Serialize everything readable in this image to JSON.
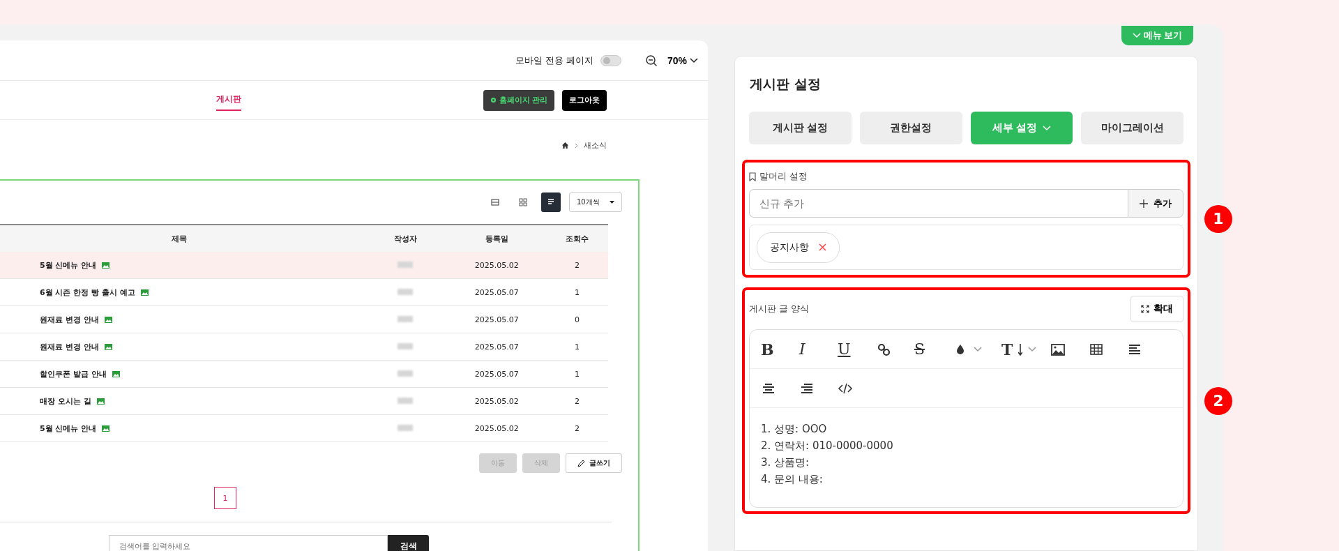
{
  "preview": {
    "mobile_toggle": {
      "label": "모바일 전용 페이지",
      "on": false
    },
    "zoom": "70%",
    "nav": [
      {
        "label": "게시판",
        "selected": true
      }
    ],
    "buttons": [
      {
        "label": "홈페이지 관리",
        "kind": "manage"
      },
      {
        "label": "로그아웃",
        "kind": "dark"
      }
    ],
    "breadcrumb": [
      "새소식"
    ],
    "view_modes": [
      {
        "selected": false
      },
      {
        "selected": false
      },
      {
        "selected": true
      }
    ],
    "page_size": "10개씩",
    "table": {
      "columns": [
        "제목",
        "작성자",
        "등록일",
        "조회수"
      ],
      "rows": [
        {
          "title": "5월 신메뉴 안내",
          "date": "2025.05.02",
          "views": "2",
          "selected": true
        },
        {
          "title": "6월 시즌 한정 빵 출시 예고",
          "date": "2025.05.07",
          "views": "1",
          "selected": false
        },
        {
          "title": "원재료 변경 안내",
          "date": "2025.05.07",
          "views": "0",
          "selected": false
        },
        {
          "title": "원재료 변경 안내",
          "date": "2025.05.07",
          "views": "1",
          "selected": false
        },
        {
          "title": "할인쿠폰 발급 안내",
          "date": "2025.05.07",
          "views": "1",
          "selected": false
        },
        {
          "title": "매장 오시는 길",
          "date": "2025.05.02",
          "views": "2",
          "selected": false
        },
        {
          "title": "5월 신메뉴 안내",
          "date": "2025.05.02",
          "views": "2",
          "selected": false
        }
      ]
    },
    "actions": [
      {
        "label": "이동",
        "disabled": true,
        "kind": "plain"
      },
      {
        "label": "삭제",
        "disabled": true,
        "kind": "plain"
      },
      {
        "label": "글쓰기",
        "disabled": false,
        "kind": "write"
      }
    ],
    "pages": [
      {
        "label": "1",
        "selected": true
      }
    ],
    "search": {
      "placeholder": "검색어를 입력하세요",
      "button": "검색"
    }
  },
  "settings": {
    "menu_button": "메뉴 보기",
    "title": "게시판 설정",
    "tabs": [
      {
        "label": "게시판 설정",
        "selected": false,
        "dropdown": false
      },
      {
        "label": "권한설정",
        "selected": false,
        "dropdown": false
      },
      {
        "label": "세부 설정",
        "selected": true,
        "dropdown": true
      },
      {
        "label": "마이그레이션",
        "selected": false,
        "dropdown": false
      }
    ],
    "header_section": {
      "annotation": "1",
      "title": "말머리 설정",
      "input": {
        "placeholder": "신규 추가"
      },
      "add_button": "추가",
      "tags": [
        "공지사항"
      ]
    },
    "template_section": {
      "annotation": "2",
      "title": "게시판 글 양식",
      "expand_button": "확대",
      "toolbar": [
        [
          {
            "kind": "bold",
            "label": "B",
            "dropdown": false
          },
          {
            "kind": "italic",
            "label": "I",
            "dropdown": false
          },
          {
            "kind": "underline",
            "label": "U",
            "dropdown": false
          },
          {
            "kind": "link",
            "dropdown": false
          },
          {
            "kind": "strike",
            "label": "S",
            "dropdown": false
          },
          {
            "kind": "color",
            "dropdown": true
          },
          {
            "kind": "size",
            "label": "T",
            "dropdown": true
          },
          {
            "kind": "image",
            "dropdown": false
          },
          {
            "kind": "table",
            "dropdown": false
          },
          {
            "kind": "alignleft",
            "dropdown": false
          }
        ],
        [
          {
            "kind": "aligncenter",
            "dropdown": false
          },
          {
            "kind": "alignright",
            "dropdown": false
          },
          {
            "kind": "code",
            "dropdown": false
          }
        ]
      ],
      "content": [
        "1. 성명: OOO",
        "2. 연락처: 010-0000-0000",
        "3. 상품명:",
        "4. 문의 내용:"
      ]
    }
  }
}
